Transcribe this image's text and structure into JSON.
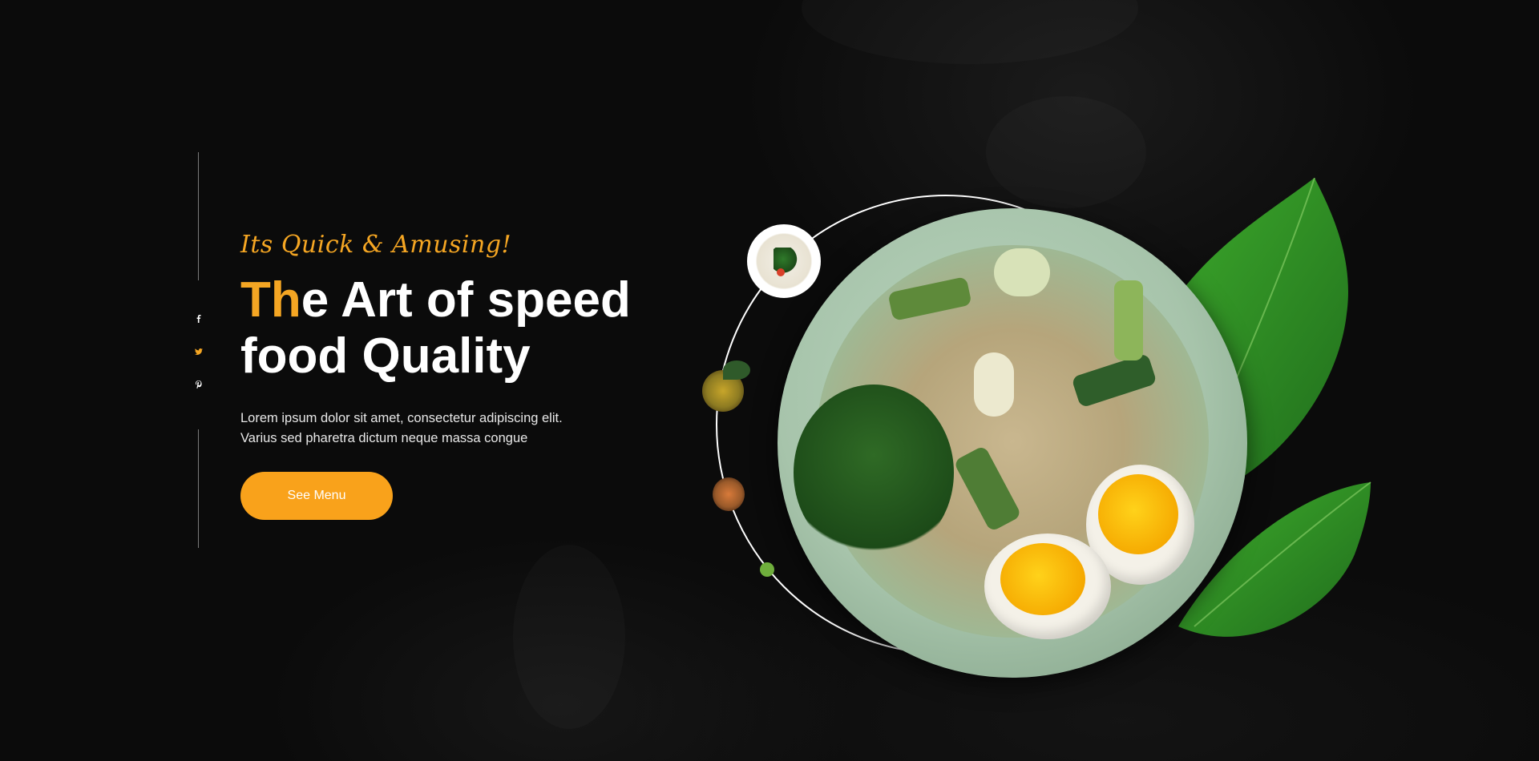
{
  "hero": {
    "tagline": "Its Quick & Amusing!",
    "title_accent": "Th",
    "title_line1_rest": "e Art of speed",
    "title_line2": "food Quality",
    "description_line1": "Lorem ipsum dolor sit amet, consectetur adipiscing elit.",
    "description_line2": "Varius sed pharetra dictum neque massa congue",
    "cta_label": "See Menu"
  },
  "social": {
    "items": [
      {
        "icon": "facebook-icon",
        "color": "#ffffff"
      },
      {
        "icon": "twitter-icon",
        "color": "#f5a623"
      },
      {
        "icon": "pinterest-icon",
        "color": "#ffffff"
      }
    ]
  },
  "colors": {
    "accent": "#f5a623",
    "button": "#f9a21b",
    "background": "#0b0b0b",
    "plate": "#a7c4ab",
    "leaf": "#2f9a2a"
  },
  "gallery": {
    "thumbnails": [
      "dish-thumb-salad",
      "dish-thumb-curry",
      "dish-thumb-bowl",
      "herb-sprig"
    ]
  }
}
